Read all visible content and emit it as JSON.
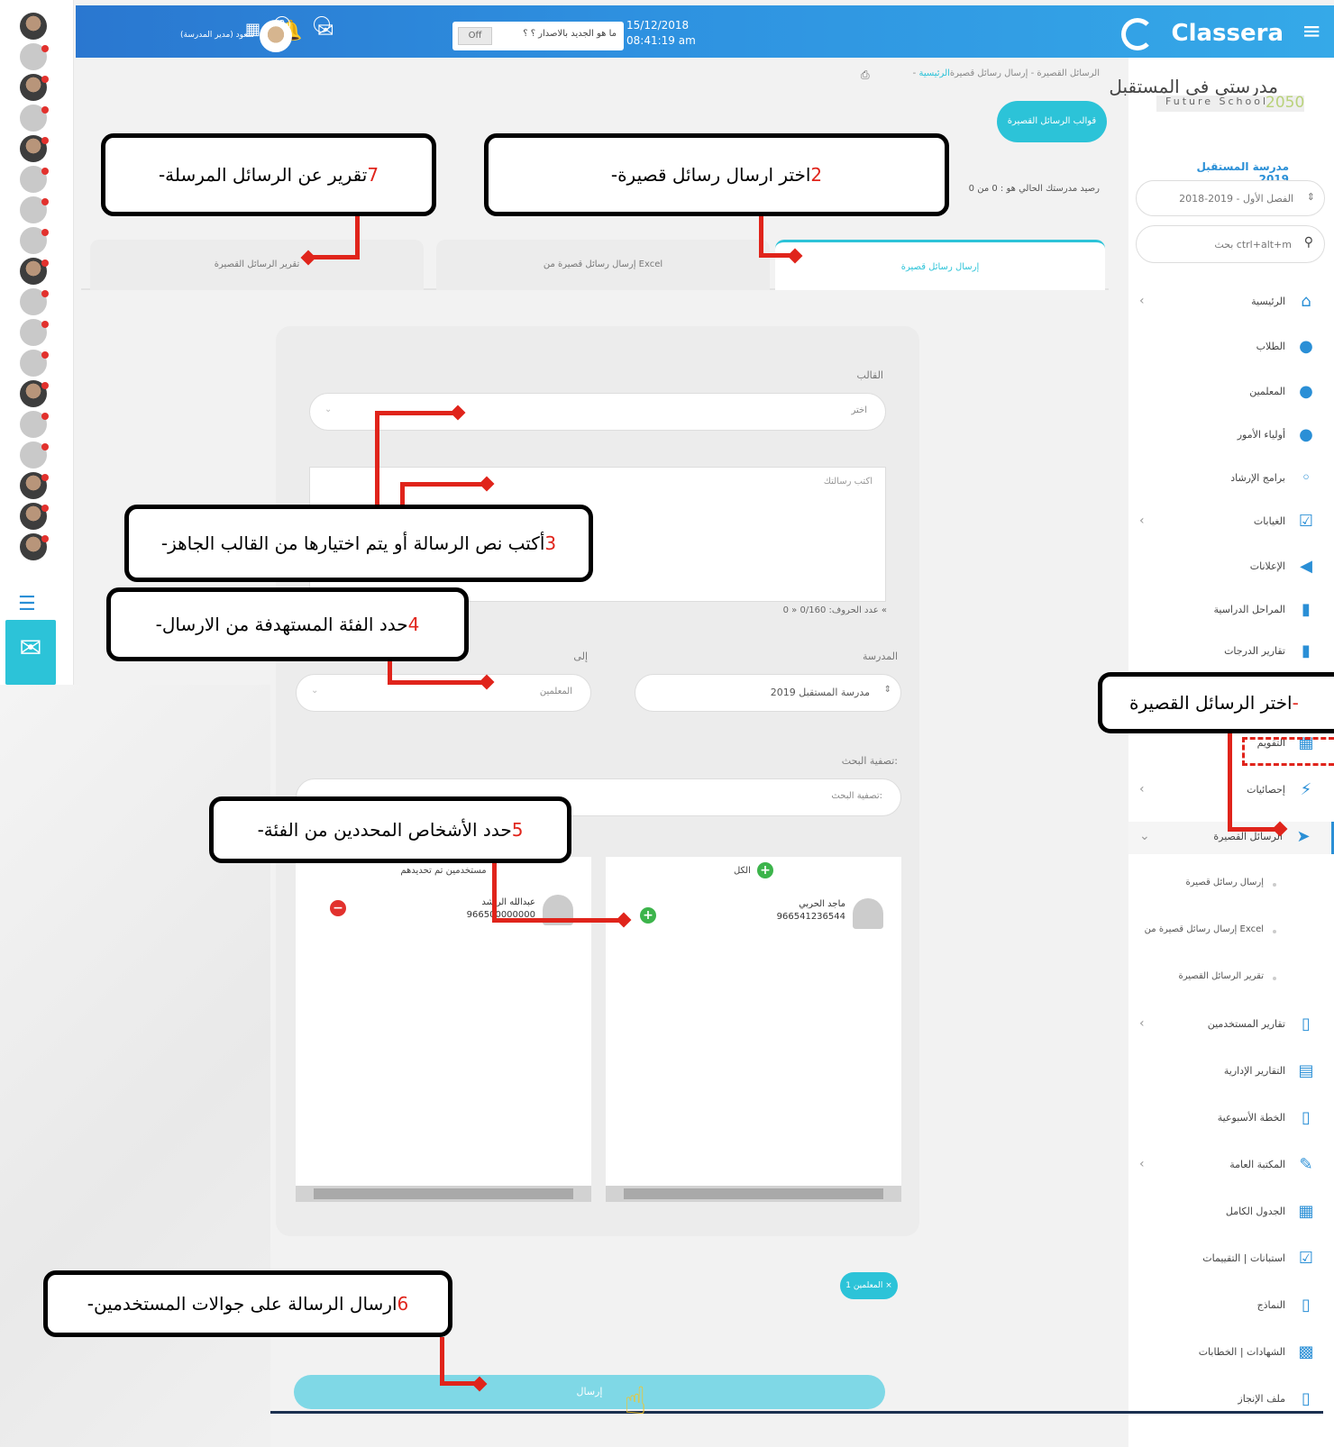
{
  "topbar": {
    "brand": "Classera",
    "date": "15/12/2018",
    "time": "08:41:19 am",
    "toggle_state": "Off",
    "whats_new": "ما هو الجديد بالاصدار ؟ ؟",
    "notif_count": "2",
    "user_name": "سعود (مدير المدرسة)"
  },
  "sidebar": {
    "school_title": "مدرستي في المستقبل",
    "school_sub": "Future School",
    "school_year": "2050",
    "school_name": "مدرسة المستقبل 2019",
    "semester": "الفصل الأول - 2019-2018",
    "search_placeholder": "بحث ctrl+alt+m",
    "items": [
      {
        "label": "الرئيسية",
        "icon": "home-icon"
      },
      {
        "label": "الطلاب",
        "icon": "user-icon"
      },
      {
        "label": "المعلمين",
        "icon": "user-icon"
      },
      {
        "label": "أولياء الأمور",
        "icon": "user-icon"
      },
      {
        "label": "برامج الإرشاد",
        "icon": "bulb-icon"
      },
      {
        "label": "الغيابات",
        "icon": "check-icon"
      },
      {
        "label": "الإعلانات",
        "icon": "megaphone-icon"
      },
      {
        "label": "المراحل الدراسية",
        "icon": "chart-icon"
      },
      {
        "label": "تقارير الدرجات",
        "icon": "bar-chart-icon"
      },
      {
        "label": "التقويم",
        "icon": "calendar-icon"
      },
      {
        "label": "إحصائيات",
        "icon": "bolt-icon"
      },
      {
        "label": "الرسائل القصيرة",
        "icon": "send-icon"
      },
      {
        "label": "إرسال رسائل قصيرة",
        "icon": ""
      },
      {
        "label": "إرسال رسائل قصيرة من Excel",
        "icon": ""
      },
      {
        "label": "تقرير الرسائل القصيرة",
        "icon": ""
      },
      {
        "label": "تقارير المستخدمين",
        "icon": "file-icon"
      },
      {
        "label": "التقارير الإدارية",
        "icon": "report-icon"
      },
      {
        "label": "الخطة الأسبوعية",
        "icon": "file-icon"
      },
      {
        "label": "المكتبة العامة",
        "icon": "leaf-icon"
      },
      {
        "label": "الجدول الكامل",
        "icon": "table-icon"
      },
      {
        "label": "استبانات | التقييمات",
        "icon": "check-icon"
      },
      {
        "label": "النماذج",
        "icon": "file-icon"
      },
      {
        "label": "الشهادات | الخطابات",
        "icon": "qr-icon"
      },
      {
        "label": "ملف الإنجاز",
        "icon": "file-icon"
      }
    ]
  },
  "breadcrumb": {
    "home": "الرئيسية",
    "rest": " - الرسائل القصيرة - إرسال رسائل قصيرة"
  },
  "templates_button": "قوالب الرسائل القصيرة",
  "balance_text": "رصيد مدرستك الحالي هو : 0 من 0",
  "tabs": {
    "send": "إرسال رسائل قصيرة",
    "excel": "إرسال رسائل قصيرة من Excel",
    "report": "تقرير الرسائل القصيرة"
  },
  "form": {
    "template_label": "القالب",
    "template_placeholder": "اختر",
    "message_placeholder": "اكتب رسالتك",
    "char_count": "عدد الحروف: 0/160 « 0 «",
    "school_label": "المدرسة",
    "school_value": "مدرسة المستقبل 2019",
    "to_label": "إلى",
    "to_value": "المعلمين",
    "filter_label": "تصفية البحث:",
    "filter_placeholder": "تصفية البحث:",
    "all_label": "الكل",
    "selected_label": "مستخدمين تم تحديدهم",
    "available_user_name": "ماجد الحربي",
    "available_user_phone": "966541236544",
    "selected_user_name": "عبدالله الراشد",
    "selected_user_phone": "966500000000",
    "chip": "المعلمين 1 ×",
    "send": "إرسال"
  },
  "callouts": {
    "c1": {
      "num": "-",
      "text": "اختر الرسائل القصيرة"
    },
    "c2": {
      "num": "2",
      "text": "-اختر ارسال رسائل قصيرة"
    },
    "c3": {
      "num": "3",
      "text": "-أكتب نص الرسالة أو يتم اختيارها من القالب الجاهز"
    },
    "c4": {
      "num": "4",
      "text": "-حدد الفئة المستهدفة من الارسال"
    },
    "c5": {
      "num": "5",
      "text": "-حدد الأشخاص المحددين من الفئة"
    },
    "c6": {
      "num": "6",
      "text": "-ارسال الرسالة على جوالات المستخدمين"
    },
    "c7": {
      "num": "7",
      "text": "-تقرير عن الرسائل المرسلة"
    }
  },
  "colors": {
    "accent": "#2cc3d8",
    "brand": "#2a77d0",
    "annotation": "#e0241b"
  }
}
